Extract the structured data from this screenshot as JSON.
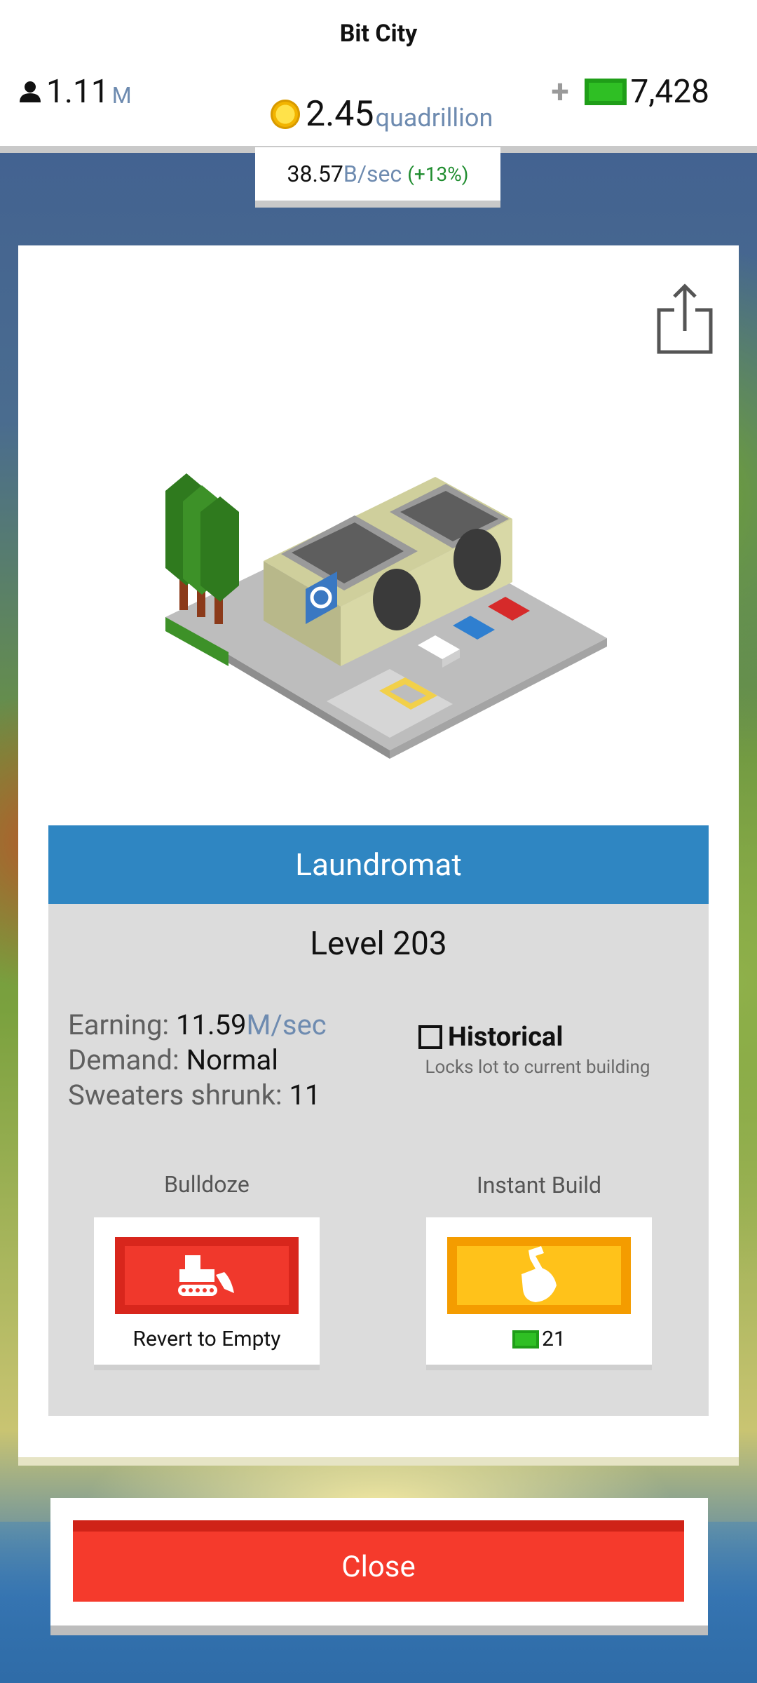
{
  "header": {
    "city_name": "Bit City",
    "population": {
      "value": "1.11",
      "unit": "M"
    },
    "coins": {
      "value": "2.45",
      "unit": "quadrillion"
    },
    "bucks": {
      "plus": "+",
      "value": "7,428"
    },
    "rate": {
      "value": "38.57",
      "unit": "B/sec",
      "bonus": "(+13%)"
    }
  },
  "building": {
    "name": "Laundromat",
    "level": "Level 203",
    "stats": {
      "earning_label": "Earning:",
      "earning_value": "11.59",
      "earning_unit": "M/sec",
      "demand_label": "Demand:",
      "demand_value": "Normal",
      "sweaters_label": "Sweaters shrunk:",
      "sweaters_value": "11"
    },
    "historical": {
      "label": "Historical",
      "description": "Locks lot to current building"
    }
  },
  "actions": {
    "bulldoze": {
      "title": "Bulldoze",
      "caption": "Revert to Empty"
    },
    "instant_build": {
      "title": "Instant Build",
      "cost": "21"
    }
  },
  "footer": {
    "close_label": "Close"
  },
  "icons": {
    "person": "person-icon",
    "coin": "coin-icon",
    "cash": "cash-icon",
    "share": "share-icon",
    "bulldozer": "bulldozer-icon",
    "hammer": "hammer-hand-icon"
  },
  "colors": {
    "title_bar": "#2f86c2",
    "bulldoze": "#f0382c",
    "instant": "#ffc21a",
    "close": "#f53a2c",
    "cash": "#2fbf24"
  }
}
